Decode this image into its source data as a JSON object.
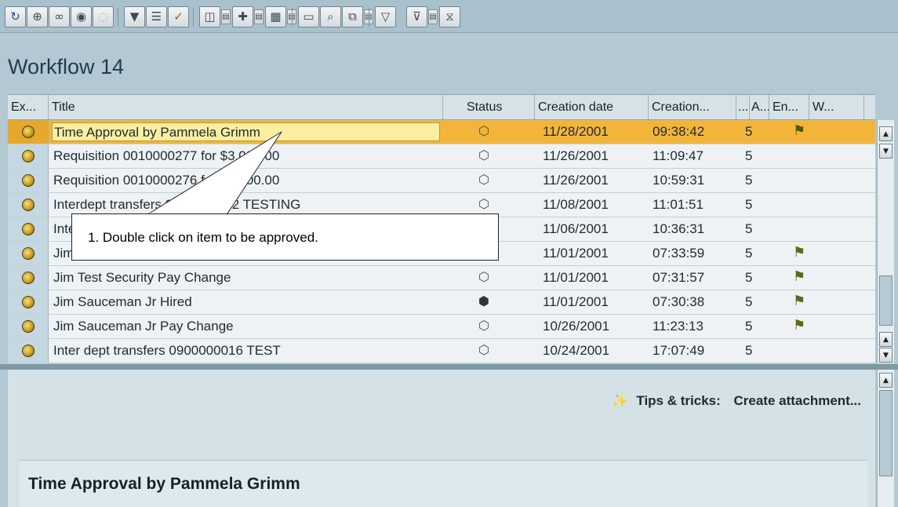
{
  "toolbar": {
    "buttons": [
      {
        "icon": "refresh-icon"
      },
      {
        "icon": "execute-icon"
      },
      {
        "icon": "forward-icon"
      },
      {
        "icon": "display-object-icon"
      },
      {
        "icon": "disabled-object-icon"
      },
      {
        "icon": "filter-title-icon"
      },
      {
        "icon": "sort-list-icon"
      },
      {
        "icon": "approve-icon"
      },
      {
        "icon": "view-icon"
      },
      {
        "icon": "create-icon"
      },
      {
        "icon": "layout-icon"
      },
      {
        "icon": "print-icon"
      },
      {
        "icon": "find-icon"
      },
      {
        "icon": "copy-icon"
      },
      {
        "icon": "filter-icon"
      },
      {
        "icon": "filter-delete-icon"
      },
      {
        "icon": "binoculars-icon"
      }
    ],
    "sub_glyph": "▤"
  },
  "page": {
    "title": "Workflow  14"
  },
  "grid": {
    "columns": {
      "ex": "Ex...",
      "title": "Title",
      "status": "Status",
      "creation_date": "Creation date",
      "creation_time": "Creation...",
      "dots": "...",
      "a": "A...",
      "en": "En...",
      "w": "W..."
    },
    "rows": [
      {
        "title": "Time Approval by Pammela Grimm",
        "status_icon": "⬡",
        "date": "11/28/2001",
        "time": "09:38:42",
        "priority": "5",
        "flag": true,
        "selected": true
      },
      {
        "title": "Requisition 0010000277 for $3,000.00",
        "status_icon": "⬡",
        "date": "11/26/2001",
        "time": "11:09:47",
        "priority": "5",
        "flag": false
      },
      {
        "title": "Requisition 0010000276 for $2,500.00",
        "status_icon": "⬡",
        "date": "11/26/2001",
        "time": "10:59:31",
        "priority": "5",
        "flag": false
      },
      {
        "title": "Interdept transfers 0900000022 TESTING",
        "status_icon": "⬡",
        "date": "11/08/2001",
        "time": "11:01:51",
        "priority": "5",
        "flag": false
      },
      {
        "title": "Interdept transfers 0900000021 TEST",
        "status_icon": "⬡",
        "date": "11/06/2001",
        "time": "10:36:31",
        "priority": "5",
        "flag": false
      },
      {
        "title": "Jim Test Security Tenure Change",
        "status_icon": "⬡",
        "date": "11/01/2001",
        "time": "07:33:59",
        "priority": "5",
        "flag": true
      },
      {
        "title": "Jim Test Security Pay Change",
        "status_icon": "⬡",
        "date": "11/01/2001",
        "time": "07:31:57",
        "priority": "5",
        "flag": true
      },
      {
        "title": "Jim Sauceman Jr Hired",
        "status_icon": "⬢",
        "date": "11/01/2001",
        "time": "07:30:38",
        "priority": "5",
        "flag": true
      },
      {
        "title": "Jim Sauceman Jr Pay Change",
        "status_icon": "⬡",
        "date": "10/26/2001",
        "time": "11:23:13",
        "priority": "5",
        "flag": true
      },
      {
        "title": "Inter dept transfers 0900000016 TEST",
        "status_icon": "⬡",
        "date": "10/24/2001",
        "time": "17:07:49",
        "priority": "5",
        "flag": false
      }
    ],
    "flag_glyph": "⚑",
    "scroll_up": "▲",
    "scroll_down": "▼"
  },
  "preview": {
    "tips_label": "Tips & tricks:",
    "tips_link": "Create attachment...",
    "wand_glyph": "✨",
    "title": "Time Approval by Pammela Grimm"
  },
  "callout": {
    "text": "1. Double click on item to be approved."
  },
  "colors": {
    "selected_row": "#f3b539",
    "toolbar": "#a9c1cc",
    "background": "#b3c8d3"
  }
}
